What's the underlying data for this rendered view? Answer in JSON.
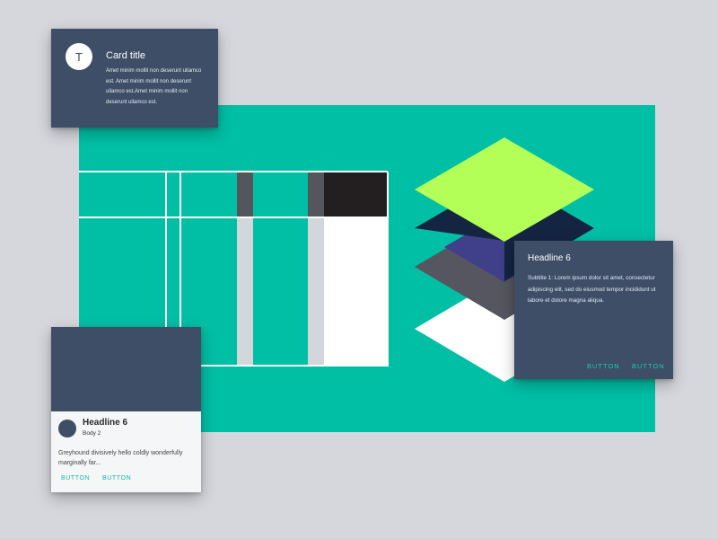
{
  "colors": {
    "background": "#d5d7dc",
    "teal": "#00bfa5",
    "card": "#3d4e66",
    "accent_button": "#1ec9b0",
    "lime": "#b3ff58",
    "navy": "#142542",
    "indigo": "#40408a",
    "slate": "#55565f"
  },
  "card_top_left": {
    "avatar_letter": "T",
    "title": "Card title",
    "body": "Amet minim mollit non deserunt ullamco est. Amet minim mollit non deserunt ullamco est.Amet minim mollit non deserunt ullamco est."
  },
  "card_right": {
    "title": "Headline 6",
    "body": "Subtitle 1: Lorem ipsum dolor sit amet, consectetur adipiscing elit, sed do eiusmod tempor incididunt ut labore et dolore magna aliqua.",
    "button_1": "BUTTON",
    "button_2": "BUTTON"
  },
  "card_bottom_left": {
    "title": "Headline 6",
    "subtitle": "Body 2",
    "body": "Greyhound divisively hello coldly wonderfully marginally far...",
    "button_1": "BUTTON",
    "button_2": "BUTTON"
  }
}
